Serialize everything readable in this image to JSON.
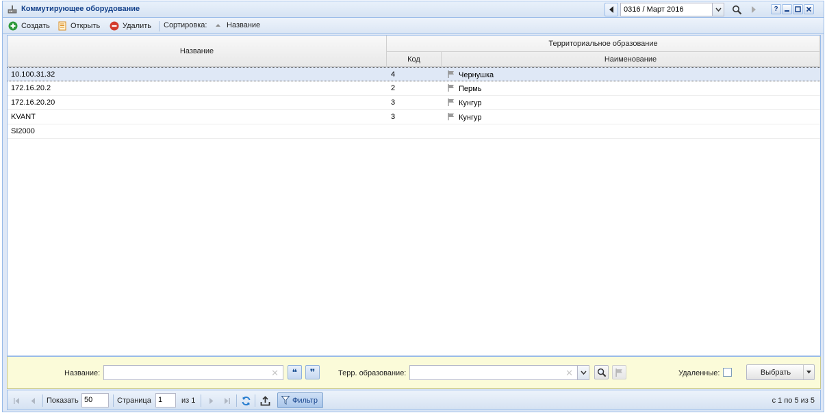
{
  "window": {
    "title": "Коммутирующее оборудование"
  },
  "period": {
    "value": "0316 / Март 2016"
  },
  "titlebar_buttons": {
    "help": "?"
  },
  "toolbar": {
    "create_label": "Создать",
    "open_label": "Открыть",
    "delete_label": "Удалить",
    "sort_label": "Сортировка:",
    "sort_field": "Название"
  },
  "grid": {
    "headers": {
      "name": "Название",
      "terr_group": "Территориальное образование",
      "code": "Код",
      "terr_name": "Наименование"
    },
    "rows": [
      {
        "name": "10.100.31.32",
        "code": "4",
        "terr": "Чернушка",
        "selected": true
      },
      {
        "name": "172.16.20.2",
        "code": "2",
        "terr": "Пермь",
        "selected": false
      },
      {
        "name": "172.16.20.20",
        "code": "3",
        "terr": "Кунгур",
        "selected": false
      },
      {
        "name": "KVANT",
        "code": "3",
        "terr": "Кунгур",
        "selected": false
      },
      {
        "name": "SI2000",
        "code": "",
        "terr": "",
        "selected": false
      }
    ]
  },
  "filter": {
    "name_label": "Название:",
    "name_value": "",
    "quote_open": "❝",
    "quote_close": "❞",
    "terr_label": "Терр. образование:",
    "terr_value": "",
    "deleted_label": "Удаленные:",
    "deleted_checked": false,
    "select_label": "Выбрать"
  },
  "paging": {
    "show_label": "Показать",
    "page_size": "50",
    "page_label": "Страница",
    "page_value": "1",
    "of_label": "из 1",
    "filter_label": "Фильтр",
    "summary": "с 1 по 5 из 5"
  },
  "colors": {
    "accent": "#15428b",
    "border": "#99bbe8",
    "selected_row": "#dfe8f6",
    "filter_bg": "#fbfbd9"
  }
}
